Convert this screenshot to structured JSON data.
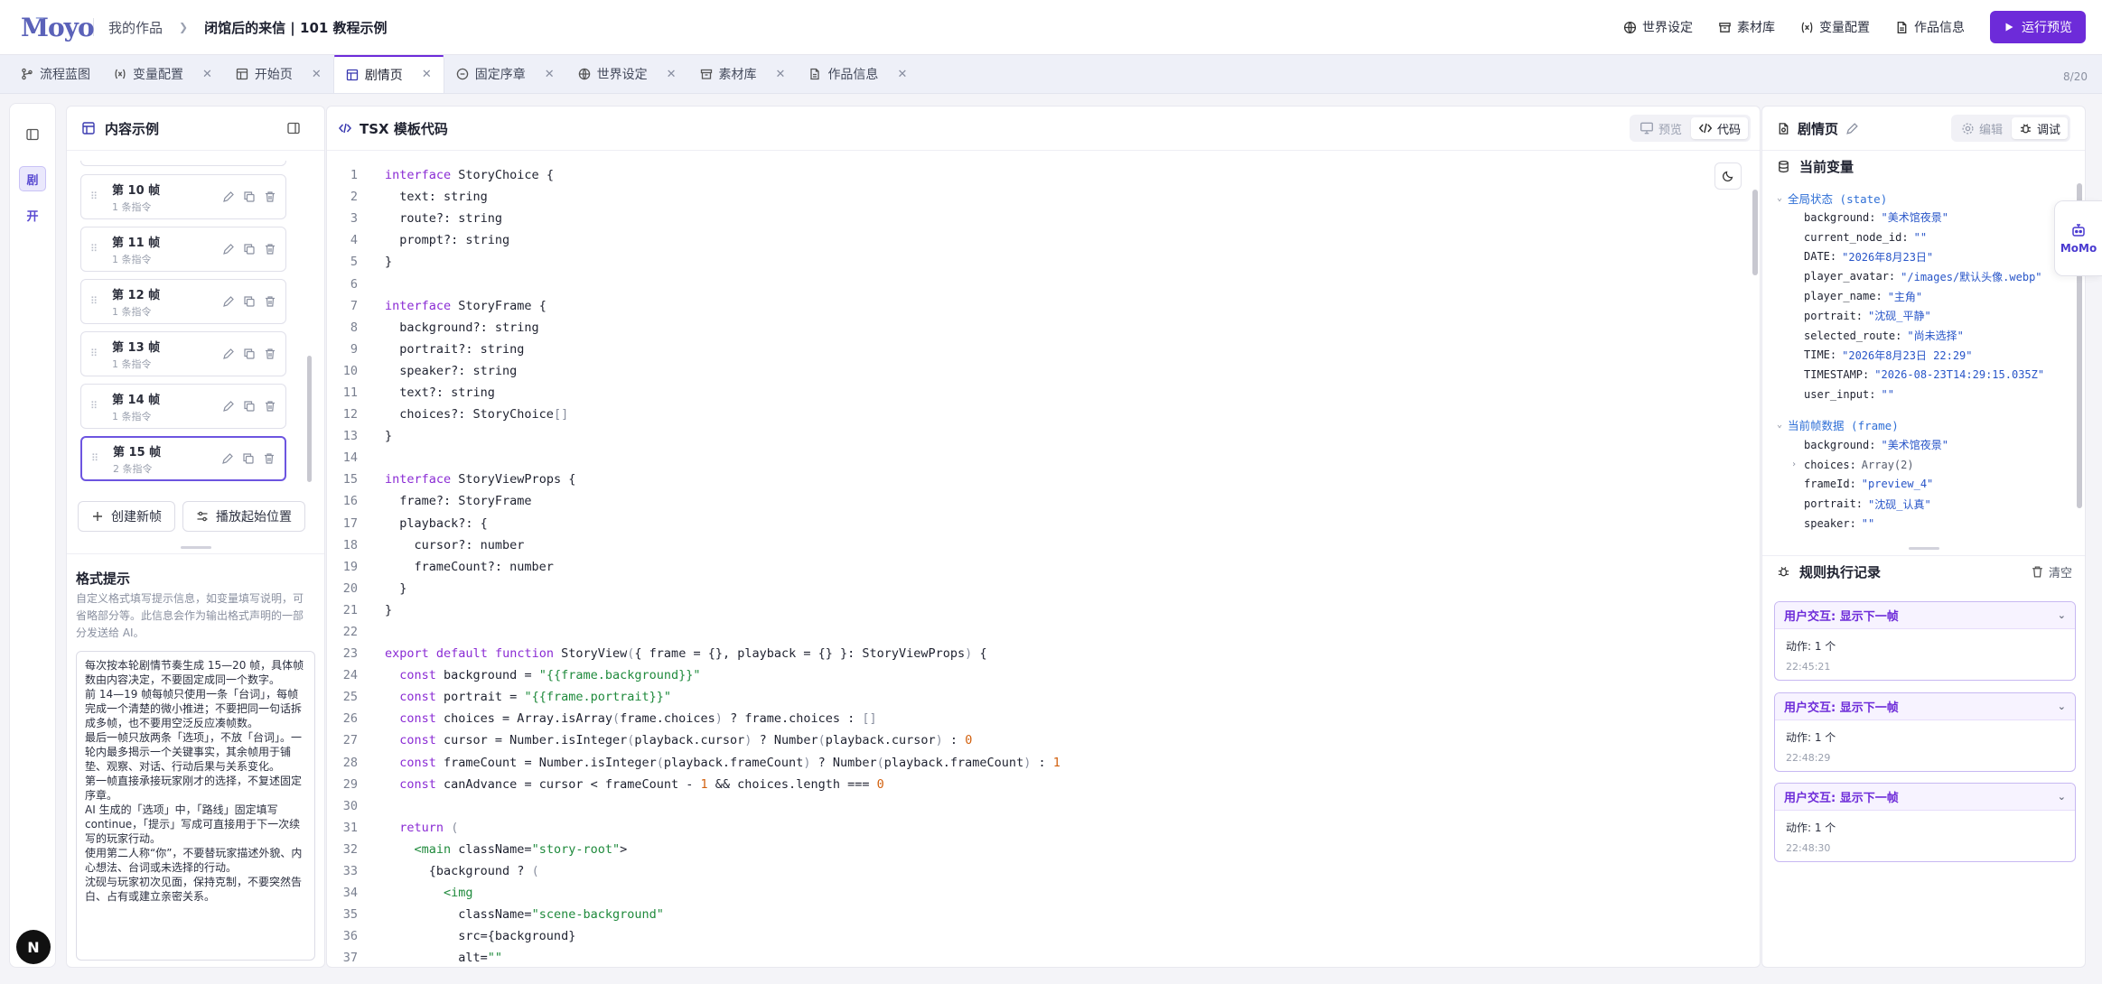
{
  "brand": {
    "logo_text": "Moyo",
    "logo_small": "ー"
  },
  "breadcrumb": {
    "parent": "我的作品",
    "current": "闭馆后的来信 | 101 教程示例"
  },
  "topnav": {
    "world": "世界设定",
    "assets": "素材库",
    "vars": "变量配置",
    "info": "作品信息",
    "run": "运行预览"
  },
  "tabs": [
    {
      "label": "流程蓝图",
      "closable": false
    },
    {
      "label": "变量配置",
      "closable": true
    },
    {
      "label": "开始页",
      "closable": true
    },
    {
      "label": "剧情页",
      "closable": true,
      "active": true
    },
    {
      "label": "固定序章",
      "closable": true
    },
    {
      "label": "世界设定",
      "closable": true
    },
    {
      "label": "素材库",
      "closable": true
    },
    {
      "label": "作品信息",
      "closable": true
    }
  ],
  "tab_count": "8/20",
  "rail": {
    "btn_a": "剧",
    "btn_b": "开",
    "avatar": "N"
  },
  "content_panel": {
    "title": "内容示例",
    "frames": [
      {
        "title": "第 10 帧",
        "sub": "1 条指令"
      },
      {
        "title": "第 11 帧",
        "sub": "1 条指令"
      },
      {
        "title": "第 12 帧",
        "sub": "1 条指令"
      },
      {
        "title": "第 13 帧",
        "sub": "1 条指令"
      },
      {
        "title": "第 14 帧",
        "sub": "1 条指令"
      },
      {
        "title": "第 15 帧",
        "sub": "2 条指令"
      }
    ],
    "create_btn": "创建新帧",
    "playback_btn": "播放起始位置",
    "format_title": "格式提示",
    "format_desc": "自定义格式填写提示信息，如变量填写说明，可省略部分等。此信息会作为输出格式声明的一部分发送给 AI。",
    "format_text": "每次按本轮剧情节奏生成 15—20 帧，具体帧数由内容决定，不要固定成同一个数字。\n前 14—19 帧每帧只使用一条「台词」，每帧完成一个清楚的微小推进；不要把同一句话拆成多帧，也不要用空泛反应凑帧数。\n最后一帧只放两条「选项」，不放「台词」。一轮内最多揭示一个关键事实，其余帧用于铺垫、观察、对话、行动后果与关系变化。\n第一帧直接承接玩家刚才的选择，不复述固定序章。\nAI 生成的「选项」中，「路线」固定填写 continue，「提示」写成可直接用于下一次续写的玩家行动。\n使用第二人称“你”，不要替玩家描述外貌、内心想法、台词或未选择的行动。\n沈砚与玩家初次见面，保持克制，不要突然告白、占有或建立亲密关系。"
  },
  "code_panel": {
    "title": "TSX 模板代码",
    "preview": "预览",
    "code": "代码",
    "lines": [
      "interface StoryChoice {",
      "  text: string",
      "  route?: string",
      "  prompt?: string",
      "}",
      "",
      "interface StoryFrame {",
      "  background?: string",
      "  portrait?: string",
      "  speaker?: string",
      "  text?: string",
      "  choices?: StoryChoice[]",
      "}",
      "",
      "interface StoryViewProps {",
      "  frame?: StoryFrame",
      "  playback?: {",
      "    cursor?: number",
      "    frameCount?: number",
      "  }",
      "}",
      "",
      "export default function StoryView({ frame = {}, playback = {} }: StoryViewProps) {",
      "  const background = \"{{frame.background}}\"",
      "  const portrait = \"{{frame.portrait}}\"",
      "  const choices = Array.isArray(frame.choices) ? frame.choices : []",
      "  const cursor = Number.isInteger(playback.cursor) ? Number(playback.cursor) : 0",
      "  const frameCount = Number.isInteger(playback.frameCount) ? Number(playback.frameCount) : 1",
      "  const canAdvance = cursor < frameCount - 1 && choices.length === 0",
      "",
      "  return (",
      "    <main className=\"story-root\">",
      "      {background ? (",
      "        <img",
      "          className=\"scene-background\"",
      "          src={background}",
      "          alt=\"\""
    ]
  },
  "right_panel": {
    "title": "剧情页",
    "edit": "编辑",
    "debug": "调试",
    "vars_title": "当前变量",
    "state_group": "全局状态 (state)",
    "state": [
      {
        "k": "background:",
        "v": "\"美术馆夜景\""
      },
      {
        "k": "current_node_id:",
        "v": "\"\""
      },
      {
        "k": "DATE:",
        "v": "\"2026年8月23日\""
      },
      {
        "k": "player_avatar:",
        "v": "\"/images/默认头像.webp\""
      },
      {
        "k": "player_name:",
        "v": "\"主角\""
      },
      {
        "k": "portrait:",
        "v": "\"沈砚_平静\""
      },
      {
        "k": "selected_route:",
        "v": "\"尚未选择\""
      },
      {
        "k": "TIME:",
        "v": "\"2026年8月23日 22:29\""
      },
      {
        "k": "TIMESTAMP:",
        "v": "\"2026-08-23T14:29:15.035Z\""
      },
      {
        "k": "user_input:",
        "v": "\"\""
      }
    ],
    "frame_group": "当前帧数据 (frame)",
    "frame": [
      {
        "k": "background:",
        "v": "\"美术馆夜景\""
      },
      {
        "k": "choices:",
        "v": "Array(2)",
        "expandable": true
      },
      {
        "k": "frameId:",
        "v": "\"preview_4\""
      },
      {
        "k": "portrait:",
        "v": "\"沈砚_认真\""
      },
      {
        "k": "speaker:",
        "v": "\"\""
      }
    ],
    "log_title": "规则执行记录",
    "clear": "清空",
    "logs": [
      {
        "title": "用户交互: 显示下一帧",
        "action": "动作: 1 个",
        "time": "22:45:21"
      },
      {
        "title": "用户交互: 显示下一帧",
        "action": "动作: 1 个",
        "time": "22:48:29"
      },
      {
        "title": "用户交互: 显示下一帧",
        "action": "动作: 1 个",
        "time": "22:48:30"
      }
    ]
  },
  "momo": "MoMo",
  "colors": {
    "accent": "#6d2bd9",
    "keyword": "#8a2bd4",
    "string": "#1f8a3c",
    "number": "#d2610f",
    "var_value": "#2855c8"
  }
}
